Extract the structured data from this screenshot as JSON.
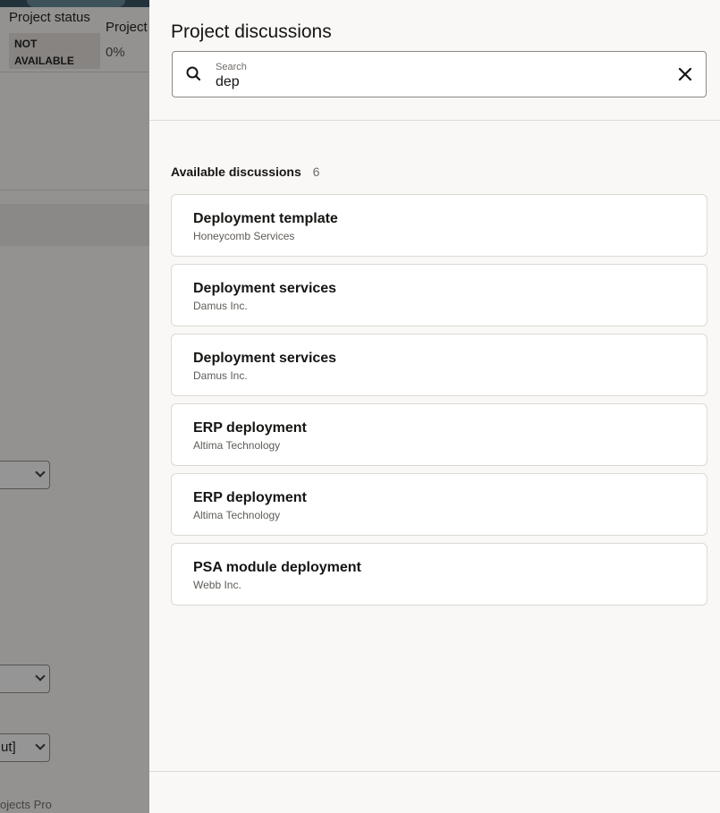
{
  "background": {
    "status_label": "Project  status",
    "project_label": "Project",
    "status_badge_line1": "NOT",
    "status_badge_line2": "AVAILABLE",
    "progress": "0%",
    "select_3_value": "ut]",
    "footer_text": "ojects Pro"
  },
  "drawer": {
    "title": "Project discussions",
    "search": {
      "label": "Search",
      "value": "dep"
    },
    "list_heading": "Available discussions",
    "list_count": "6",
    "discussions": [
      {
        "title": "Deployment template",
        "subtitle": "Honeycomb Services"
      },
      {
        "title": "Deployment services",
        "subtitle": "Damus Inc."
      },
      {
        "title": "Deployment services",
        "subtitle": "Damus Inc."
      },
      {
        "title": "ERP deployment",
        "subtitle": "Altima Technology"
      },
      {
        "title": "ERP deployment",
        "subtitle": "Altima Technology"
      },
      {
        "title": "PSA module deployment",
        "subtitle": "Webb Inc."
      }
    ]
  },
  "icons": {
    "search": "search-icon",
    "clear": "close-icon"
  },
  "colors": {
    "scrim": "#161513",
    "card_border": "#dcd9d4",
    "drawer_bg": "#f9f8f6"
  }
}
